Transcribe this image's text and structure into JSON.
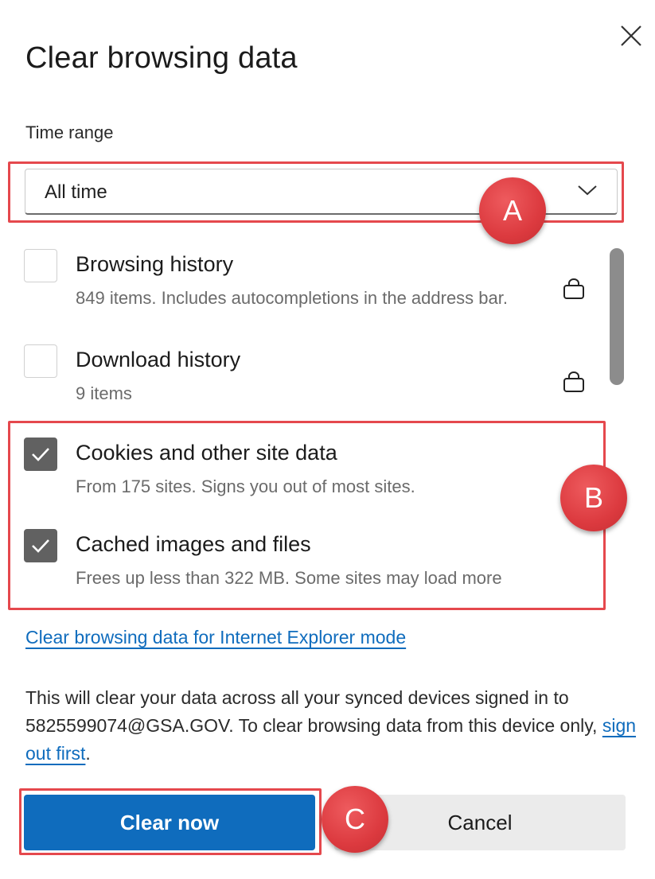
{
  "dialog": {
    "title": "Clear browsing data",
    "close_label": "×"
  },
  "time_range": {
    "label": "Time range",
    "selected": "All time"
  },
  "options": [
    {
      "label": "Browsing history",
      "description": "849 items. Includes autocompletions in the address bar.",
      "checked": false,
      "locked": true
    },
    {
      "label": "Download history",
      "description": "9 items",
      "checked": false,
      "locked": true
    },
    {
      "label": "Cookies and other site data",
      "description": "From 175 sites. Signs you out of most sites.",
      "checked": true,
      "locked": false
    },
    {
      "label": "Cached images and files",
      "description": "Frees up less than 322 MB. Some sites may load more",
      "checked": true,
      "locked": false
    }
  ],
  "ie_link": "Clear browsing data for Internet Explorer mode",
  "sync_note": {
    "text": "This will clear your data across all your synced devices signed in to 5825599074@GSA.GOV. To clear browsing data from this device only, ",
    "link": "sign out first",
    "end": "."
  },
  "buttons": {
    "clear_now": "Clear now",
    "cancel": "Cancel"
  },
  "annotations": {
    "a": "A",
    "b": "B",
    "c": "C"
  },
  "colors": {
    "accent": "#0f6cbd",
    "highlight": "#e5484d",
    "checkbox_checked": "#616161"
  }
}
